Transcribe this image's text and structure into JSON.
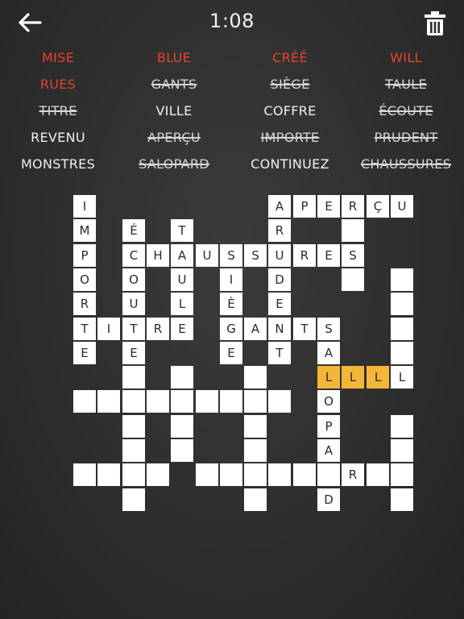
{
  "header": {
    "timer": "1:08",
    "back_icon": "arrow-left-icon",
    "trash_icon": "trash-icon"
  },
  "word_list": [
    [
      {
        "text": "MISE",
        "state": "red"
      },
      {
        "text": "BLUE",
        "state": "red"
      },
      {
        "text": "CRÉÉ",
        "state": "red"
      },
      {
        "text": "WILL",
        "state": "red"
      }
    ],
    [
      {
        "text": "RUES",
        "state": "red"
      },
      {
        "text": "GANTS",
        "state": "done"
      },
      {
        "text": "SIÈGE",
        "state": "done"
      },
      {
        "text": "TAULE",
        "state": "done"
      }
    ],
    [
      {
        "text": "TITRE",
        "state": "done"
      },
      {
        "text": "VILLE",
        "state": "normal"
      },
      {
        "text": "COFFRE",
        "state": "normal"
      },
      {
        "text": "ÉCOUTE",
        "state": "done"
      }
    ],
    [
      {
        "text": "REVENU",
        "state": "normal"
      },
      {
        "text": "APERÇU",
        "state": "done"
      },
      {
        "text": "IMPORTE",
        "state": "done"
      },
      {
        "text": "PRUDENT",
        "state": "done"
      }
    ],
    [
      {
        "text": "MONSTRES",
        "state": "normal"
      },
      {
        "text": "SALOPARD",
        "state": "done"
      },
      {
        "text": "CONTINUEZ",
        "state": "normal"
      },
      {
        "text": "CHAUSSURES",
        "state": "done"
      }
    ]
  ],
  "grid_rows": [
    "I.......APERÇU",
    "M.É.T...R..#..",
    "P.CHAUSSURES..",
    "O.O.U.I.D..#.#",
    "R.U.L.È.E....#",
    "TITRE.GANTS..#",
    "E.E...E.T.A..#",
    "..#.#..#..LLLL",
    "#########.O...",
    "..#.#..#..P..#",
    "..#.#..#..A..#",
    "####.######R##",
    "..#....#..D..#"
  ],
  "highlight_row": 7,
  "highlight_cols": [
    9,
    10,
    11,
    12
  ],
  "colors": {
    "red": "#e8422e",
    "highlight": "#f4b63a",
    "cell": "#ffffff",
    "background": "#2e2e2e"
  }
}
